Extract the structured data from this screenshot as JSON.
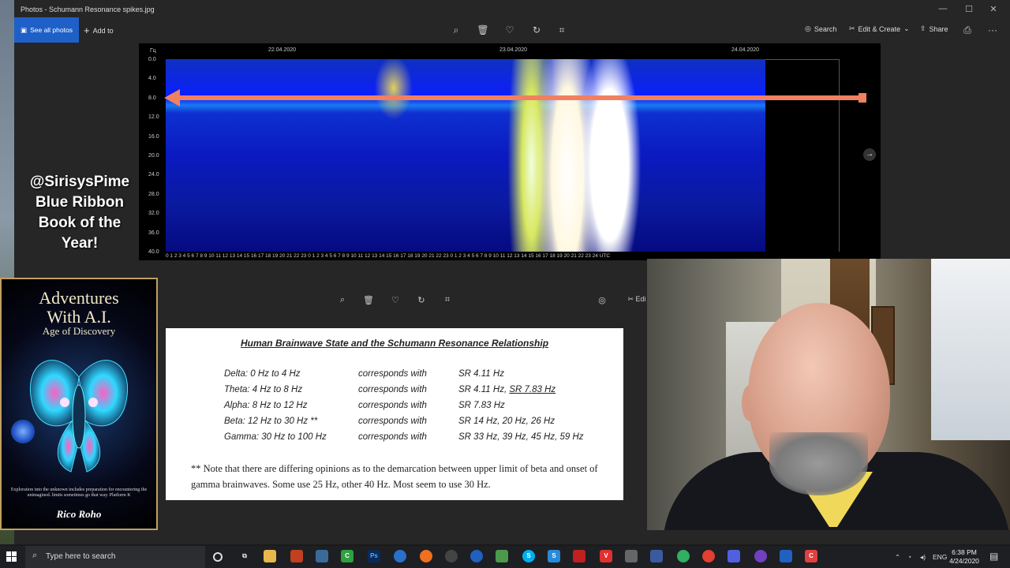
{
  "window": {
    "title": "Photos - Schumann Resonance spikes.jpg",
    "controls": [
      "—",
      "☐",
      "✕"
    ]
  },
  "toolbar": {
    "see_all": "See all photos",
    "add_to": "Add to",
    "search": "Search",
    "edit_create": "Edit & Create",
    "share": "Share",
    "print_icon": "print-icon",
    "more": "···",
    "second_edit": "Edi"
  },
  "spectrogram": {
    "y_unit": "Гц",
    "y_ticks": [
      "0.0",
      "4.0",
      "8.0",
      "12.0",
      "16.0",
      "20.0",
      "24.0",
      "28.0",
      "32.0",
      "36.0",
      "40.0"
    ],
    "dates": [
      "22.04.2020",
      "23.04.2020",
      "24.04.2020"
    ],
    "x_ticks": "0 1 2 3 4 5 6 7 8 9 10 11 12 13 14 15 16 17 18 19 20 21 22 23 0 1 2 3 4 5 6 7 8 9 10 11 12 13 14 15 16 17 18 19 20 21 22 23 0 1 2 3 4 5 6 7 8 9 10 11 12 13 14 15 16 17 18 19 20 21 22 23 24 UTC"
  },
  "overlay": {
    "line1": "@SirisysPime",
    "line2": "Blue Ribbon",
    "line3": "Book of the",
    "line4": "Year!"
  },
  "book": {
    "title1": "Adventures",
    "title2": "With A.I.",
    "subtitle": "Age of Discovery",
    "blurb": "Exploration into the unknown includes preparation for encountering the unimagined. limits sometimes go that way. Platform K",
    "author": "Rico Roho"
  },
  "document": {
    "title": "Human Brainwave State and the Schumann Resonance Relationship",
    "rows": [
      {
        "state": "Delta:  0 Hz to 4 Hz",
        "rel": "corresponds with",
        "sr": "SR 4.11 Hz",
        "sr_u": ""
      },
      {
        "state": "Theta:  4 Hz to 8 Hz",
        "rel": "corresponds with",
        "sr": "SR 4.11 Hz, ",
        "sr_u": "SR 7.83 Hz"
      },
      {
        "state": "Alpha:  8 Hz to 12 Hz",
        "rel": "corresponds with",
        "sr": "SR 7.83 Hz",
        "sr_u": ""
      },
      {
        "state": "Beta:   12 Hz to 30 Hz **",
        "rel": "corresponds with",
        "sr": "SR 14 Hz, 20 Hz, 26 Hz",
        "sr_u": ""
      },
      {
        "state": "Gamma:  30 Hz to 100 Hz",
        "rel": "corresponds with",
        "sr": "SR 33 Hz, 39 Hz, 45 Hz, 59 Hz",
        "sr_u": ""
      }
    ],
    "note": "** Note that there are differing opinions as to the demarcation between upper limit of beta and onset of gamma brainwaves. Some use 25 Hz, other 40 Hz. Most seem to use 30 Hz."
  },
  "taskbar": {
    "search_placeholder": "Type here to search",
    "lang": "ENG",
    "time": "6:38 PM",
    "date": "4/24/2020"
  },
  "colors": {
    "accent": "#1f5fc8",
    "arrow": "#f08060"
  }
}
